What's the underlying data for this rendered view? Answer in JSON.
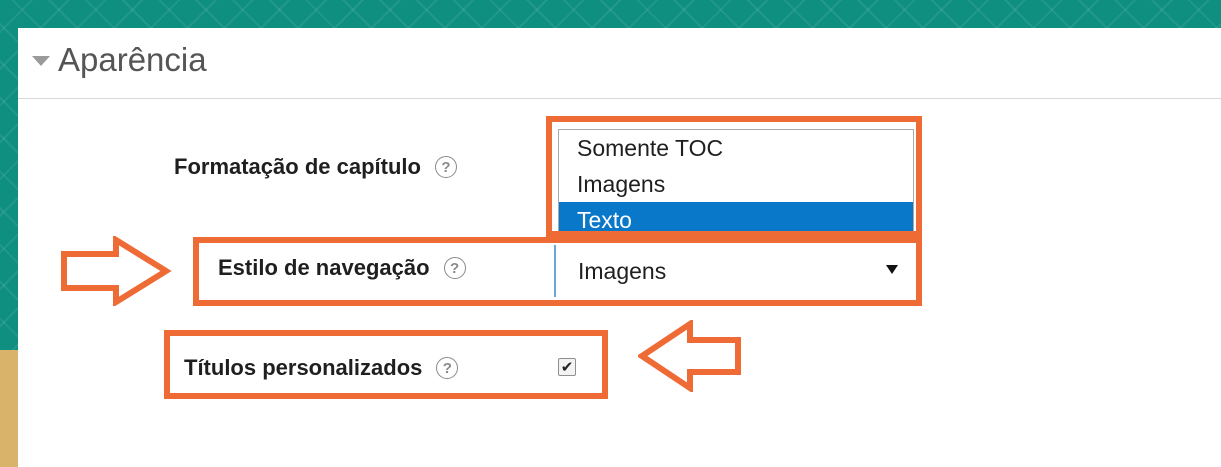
{
  "section": {
    "title": "Aparência"
  },
  "fields": {
    "chapter_formatting": {
      "label": "Formatação de capítulo",
      "options": [
        "Somente TOC",
        "Imagens",
        "Texto"
      ],
      "highlighted_option": "Texto"
    },
    "navigation_style": {
      "label": "Estilo de navegação",
      "value": "Imagens"
    },
    "custom_titles": {
      "label": "Títulos personalizados",
      "checked": true
    }
  },
  "colors": {
    "highlight": "#ef6b36",
    "selected_option_bg": "#0a78c8",
    "background": "#0f8f80"
  },
  "icons": {
    "section_toggle": "caret-down-icon",
    "help": "help-icon",
    "dropdown": "dropdown-arrow-icon",
    "checkmark": "checkmark-icon",
    "annotation": "outline-arrow-icon"
  }
}
